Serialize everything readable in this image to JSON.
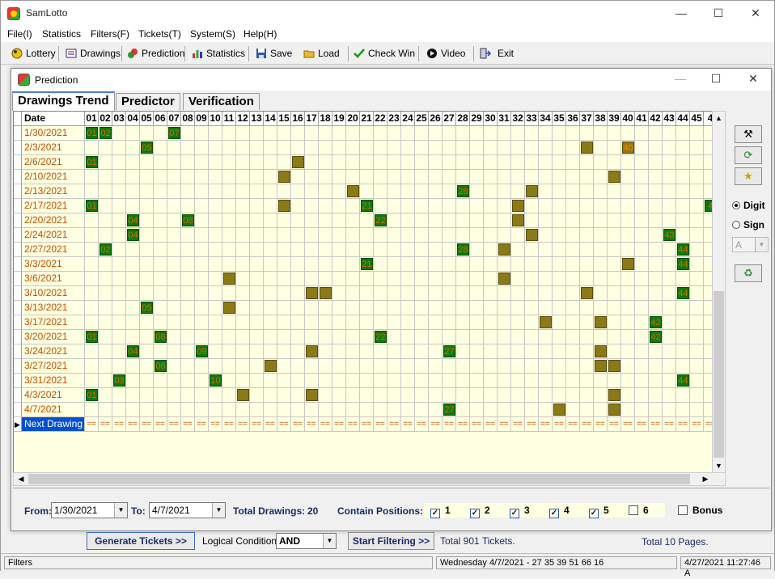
{
  "app": {
    "title": "SamLotto"
  },
  "menu": [
    "File(I)",
    "Statistics",
    "Filters(F)",
    "Tickets(T)",
    "System(S)",
    "Help(H)"
  ],
  "toolbar": [
    {
      "label": "Lottery",
      "icon": "ball-icon"
    },
    {
      "label": "Drawings",
      "icon": "drawings-icon"
    },
    {
      "label": "Prediction",
      "icon": "prediction-icon"
    },
    {
      "label": "Statistics",
      "icon": "bar-chart-icon"
    },
    {
      "label": "Save",
      "icon": "floppy-icon"
    },
    {
      "label": "Load",
      "icon": "folder-open-icon"
    },
    {
      "label": "Check Win",
      "icon": "check-icon"
    },
    {
      "label": "Video",
      "icon": "play-icon"
    },
    {
      "label": "Exit",
      "icon": "exit-icon"
    }
  ],
  "prediction": {
    "title": "Prediction",
    "tabs": [
      "Drawings Trend",
      "Predictor",
      "Verification"
    ],
    "grid": {
      "date_header": "Date",
      "columns": [
        "01",
        "02",
        "03",
        "04",
        "05",
        "06",
        "07",
        "08",
        "09",
        "10",
        "11",
        "12",
        "13",
        "14",
        "15",
        "16",
        "17",
        "18",
        "19",
        "20",
        "21",
        "22",
        "23",
        "24",
        "25",
        "26",
        "27",
        "28",
        "29",
        "30",
        "31",
        "32",
        "33",
        "34",
        "35",
        "36",
        "37",
        "38",
        "39",
        "40",
        "41",
        "42",
        "43",
        "44",
        "45",
        "4"
      ],
      "rows": [
        {
          "date": "1/30/2021",
          "marks": [
            [
              1,
              "01",
              "g"
            ],
            [
              2,
              "02",
              "g"
            ],
            [
              7,
              "07",
              "g"
            ]
          ]
        },
        {
          "date": "2/3/2021",
          "marks": [
            [
              5,
              "05",
              "g"
            ],
            [
              37,
              "",
              "o"
            ],
            [
              40,
              "40",
              "o"
            ]
          ]
        },
        {
          "date": "2/6/2021",
          "marks": [
            [
              1,
              "01",
              "g"
            ],
            [
              16,
              "",
              "o"
            ]
          ]
        },
        {
          "date": "2/10/2021",
          "marks": [
            [
              15,
              "",
              "o"
            ],
            [
              39,
              "",
              "o"
            ]
          ]
        },
        {
          "date": "2/13/2021",
          "marks": [
            [
              20,
              "",
              "o"
            ],
            [
              28,
              "28",
              "g"
            ],
            [
              33,
              "",
              "o"
            ]
          ]
        },
        {
          "date": "2/17/2021",
          "marks": [
            [
              1,
              "01",
              "g"
            ],
            [
              15,
              "",
              "o"
            ],
            [
              21,
              "21",
              "g"
            ],
            [
              32,
              "",
              "o"
            ],
            [
              46,
              "4",
              "g"
            ]
          ]
        },
        {
          "date": "2/20/2021",
          "marks": [
            [
              4,
              "04",
              "g"
            ],
            [
              8,
              "08",
              "g"
            ],
            [
              22,
              "22",
              "g"
            ],
            [
              32,
              "",
              "o"
            ]
          ]
        },
        {
          "date": "2/24/2021",
          "marks": [
            [
              4,
              "04",
              "g"
            ],
            [
              33,
              "",
              "o"
            ],
            [
              43,
              "43",
              "g"
            ]
          ]
        },
        {
          "date": "2/27/2021",
          "marks": [
            [
              2,
              "02",
              "g"
            ],
            [
              28,
              "28",
              "g"
            ],
            [
              31,
              "",
              "o"
            ],
            [
              44,
              "44",
              "g"
            ]
          ]
        },
        {
          "date": "3/3/2021",
          "marks": [
            [
              21,
              "21",
              "g"
            ],
            [
              40,
              "",
              "o"
            ],
            [
              44,
              "44",
              "g"
            ]
          ]
        },
        {
          "date": "3/6/2021",
          "marks": [
            [
              11,
              "",
              "o"
            ],
            [
              31,
              "",
              "o"
            ]
          ]
        },
        {
          "date": "3/10/2021",
          "marks": [
            [
              17,
              "",
              "o"
            ],
            [
              18,
              "",
              "o"
            ],
            [
              37,
              "",
              "o"
            ],
            [
              44,
              "44",
              "g"
            ]
          ]
        },
        {
          "date": "3/13/2021",
          "marks": [
            [
              5,
              "05",
              "g"
            ],
            [
              11,
              "",
              "o"
            ]
          ]
        },
        {
          "date": "3/17/2021",
          "marks": [
            [
              34,
              "",
              "o"
            ],
            [
              38,
              "",
              "o"
            ],
            [
              42,
              "42",
              "g"
            ]
          ]
        },
        {
          "date": "3/20/2021",
          "marks": [
            [
              1,
              "01",
              "g"
            ],
            [
              6,
              "06",
              "g"
            ],
            [
              22,
              "22",
              "g"
            ],
            [
              42,
              "42",
              "g"
            ]
          ]
        },
        {
          "date": "3/24/2021",
          "marks": [
            [
              4,
              "04",
              "g"
            ],
            [
              9,
              "09",
              "g"
            ],
            [
              17,
              "",
              "o"
            ],
            [
              27,
              "27",
              "g"
            ],
            [
              38,
              "",
              "o"
            ]
          ]
        },
        {
          "date": "3/27/2021",
          "marks": [
            [
              6,
              "06",
              "g"
            ],
            [
              14,
              "",
              "o"
            ],
            [
              38,
              "",
              "o"
            ],
            [
              39,
              "",
              "o"
            ]
          ]
        },
        {
          "date": "3/31/2021",
          "marks": [
            [
              3,
              "03",
              "g"
            ],
            [
              10,
              "10",
              "g"
            ],
            [
              44,
              "44",
              "g"
            ]
          ]
        },
        {
          "date": "4/3/2021",
          "marks": [
            [
              1,
              "01",
              "g"
            ],
            [
              12,
              "",
              "o"
            ],
            [
              17,
              "",
              "o"
            ],
            [
              39,
              "",
              "o"
            ]
          ]
        },
        {
          "date": "4/7/2021",
          "marks": [
            [
              27,
              "27",
              "g"
            ],
            [
              35,
              "",
              "o"
            ],
            [
              39,
              "",
              "o"
            ]
          ]
        }
      ],
      "next_drawing_label": "Next Drawing",
      "next_drawing_fill": "=="
    },
    "side": {
      "digit_label": "Digit",
      "sign_label": "Sign",
      "sign_value": "A"
    },
    "filter": {
      "from_label": "From:",
      "from_value": "1/30/2021",
      "to_label": "To:",
      "to_value": "4/7/2021",
      "total_label": "Total Drawings:",
      "total_value": "20",
      "contain_label": "Contain Positions:",
      "positions": [
        {
          "label": "1",
          "checked": true
        },
        {
          "label": "2",
          "checked": true
        },
        {
          "label": "3",
          "checked": true
        },
        {
          "label": "4",
          "checked": true
        },
        {
          "label": "5",
          "checked": true
        },
        {
          "label": "6",
          "checked": false
        }
      ],
      "bonus_label": "Bonus"
    }
  },
  "bottom": {
    "generate_label": "Generate Tickets >>",
    "logical_label": "Logical Condition:",
    "logical_value": "AND",
    "start_filter_label": "Start Filtering >>",
    "total_tickets": "Total 901 Tickets.",
    "total_pages": "Total 10 Pages."
  },
  "status": {
    "left": "Filters",
    "center": "Wednesday 4/7/2021 - 27 35 39 51 66 16",
    "right": "4/27/2021 11:27:46 A"
  },
  "colors": {
    "hit_green": "#0d7a0d",
    "repeat_olive": "#8b7a18",
    "grid_bg": "#ffffe1",
    "date_text": "#c05000"
  }
}
